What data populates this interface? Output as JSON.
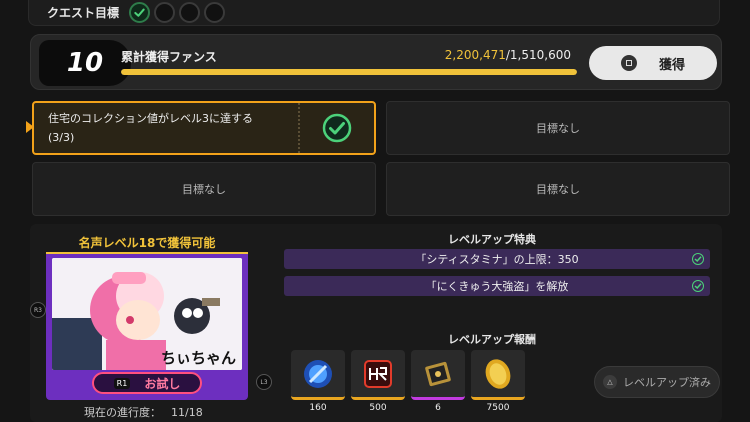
{
  "quest": {
    "label": "クエスト目標",
    "slots": [
      {
        "state": "done",
        "icon": "check-icon"
      },
      {
        "state": "empty"
      },
      {
        "state": "empty"
      },
      {
        "state": "empty"
      }
    ]
  },
  "fans": {
    "level": "10",
    "title": "累計獲得ファンス",
    "current": "2,200,471",
    "target": "/1,510,600",
    "progress_fraction": 1.0,
    "claim_label": "獲得",
    "accent": "#f0c23a"
  },
  "goals": [
    {
      "text_line1": "住宅のコレクション値がレベル3に達する",
      "text_line2": "(3/3)",
      "completed": true
    },
    {
      "text": "目標なし"
    },
    {
      "text": "目標なし"
    },
    {
      "text": "目標なし"
    }
  ],
  "character": {
    "unlock_title": "名声レベル18で獲得可能",
    "name": "ちぃちゃん",
    "try_button_key": "R1",
    "try_button_label": "お試し",
    "progress_label": "現在の進行度：",
    "progress_value": "11/18",
    "badge_left": "R3",
    "badge_right": "L3"
  },
  "perks": {
    "title": "レベルアップ特典",
    "items": [
      {
        "text": "「シティスタミナ」の上限：350",
        "done": true
      },
      {
        "text": "「にくきゅう大強盗」を解放",
        "done": true
      }
    ]
  },
  "rewards": {
    "title": "レベルアップ報酬",
    "items": [
      {
        "icon": "blue-orb-icon",
        "count": "160",
        "rarity": "gold"
      },
      {
        "icon": "hunter-card-icon",
        "count": "500",
        "rarity": "gold"
      },
      {
        "icon": "gold-ticket-icon",
        "count": "6",
        "rarity": "purple"
      },
      {
        "icon": "gold-coin-icon",
        "count": "7500",
        "rarity": "gold"
      }
    ],
    "done_label": "レベルアップ済み"
  }
}
